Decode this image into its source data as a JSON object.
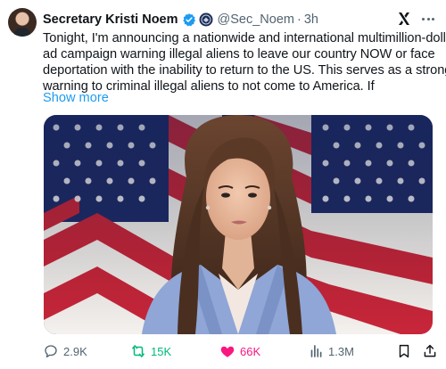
{
  "author": {
    "display_name": "Secretary Kristi Noem",
    "handle": "@Sec_Noem",
    "separator": "·",
    "time": "3h"
  },
  "tweet": {
    "lines": [
      "Tonight, I'm announcing a nationwide and international multimillion-dollar",
      "ad campaign warning illegal aliens to leave our country NOW or face",
      "deportation with the inability to return to the US. This serves as a strong",
      "warning to criminal illegal aliens to not come to America. If"
    ],
    "show_more": "Show more"
  },
  "actions": {
    "replies": "2.9K",
    "reposts": "15K",
    "likes": "66K",
    "views": "1.3M"
  },
  "colors": {
    "text": "#0f1419",
    "muted": "#536471",
    "link": "#1d9bf0",
    "verified": "#1d9bf0",
    "repost_active": "#00ba7c",
    "like_active": "#f91880"
  },
  "icons": [
    "verified-badge-icon",
    "government-seal-icon",
    "grok-icon",
    "more-icon",
    "reply-icon",
    "repost-icon",
    "like-icon",
    "views-icon",
    "bookmark-icon",
    "share-icon"
  ]
}
